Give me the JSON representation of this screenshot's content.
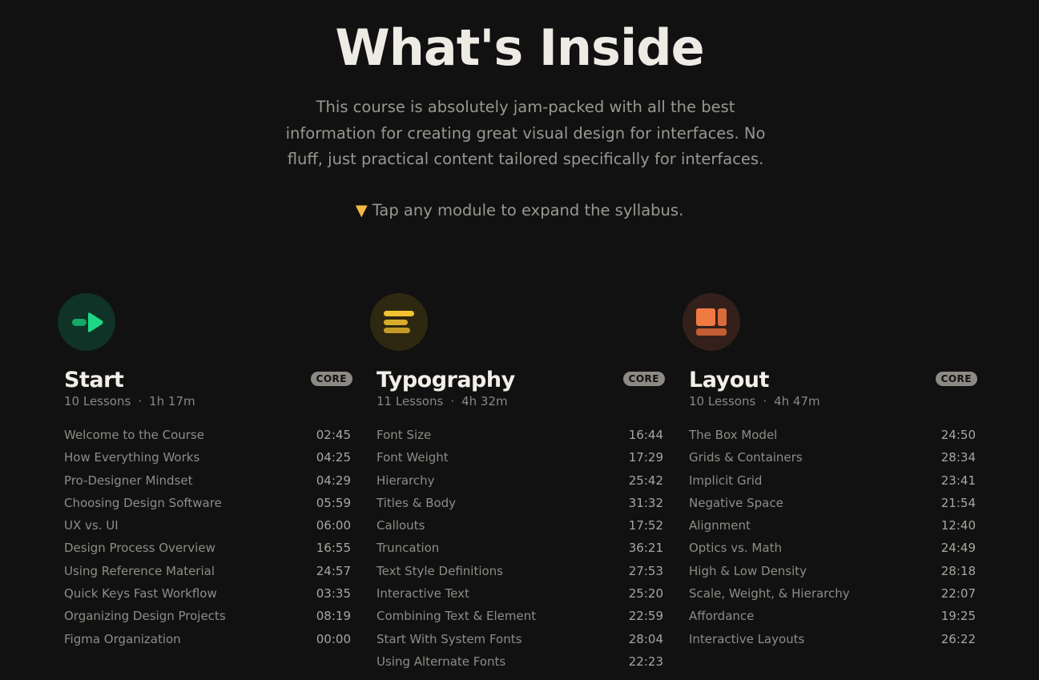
{
  "header": {
    "title": "What's Inside",
    "intro": "This course is absolutely jam-packed with all the best information for creating great visual design for interfaces. No fluff, just practical content tailored specifically for interfaces.",
    "hint": "Tap any module to expand the syllabus."
  },
  "colors": {
    "background": "#111111",
    "start_accent": "#1ed784",
    "typography_accent": "#f2c230",
    "layout_accent": "#f07a43"
  },
  "modules": [
    {
      "icon": "start-arrow-icon",
      "title": "Start",
      "badge": "CORE",
      "lessons_count": "10 Lessons",
      "duration": "1h 17m",
      "lessons": [
        {
          "name": "Welcome to the Course",
          "time": "02:45"
        },
        {
          "name": "How Everything Works",
          "time": "04:25"
        },
        {
          "name": "Pro-Designer Mindset",
          "time": "04:29"
        },
        {
          "name": "Choosing Design Software",
          "time": "05:59"
        },
        {
          "name": "UX vs. UI",
          "time": "06:00"
        },
        {
          "name": "Design Process Overview",
          "time": "16:55"
        },
        {
          "name": "Using Reference Material",
          "time": "24:57"
        },
        {
          "name": "Quick Keys Fast Workflow",
          "time": "03:35"
        },
        {
          "name": "Organizing Design Projects",
          "time": "08:19"
        },
        {
          "name": "Figma Organization",
          "time": "00:00"
        }
      ]
    },
    {
      "icon": "text-lines-icon",
      "title": "Typography",
      "badge": "CORE",
      "lessons_count": "11 Lessons",
      "duration": "4h 32m",
      "lessons": [
        {
          "name": "Font Size",
          "time": "16:44"
        },
        {
          "name": "Font Weight",
          "time": "17:29"
        },
        {
          "name": "Hierarchy",
          "time": "25:42"
        },
        {
          "name": "Titles & Body",
          "time": "31:32"
        },
        {
          "name": "Callouts",
          "time": "17:52"
        },
        {
          "name": "Truncation",
          "time": "36:21"
        },
        {
          "name": "Text Style Definitions",
          "time": "27:53"
        },
        {
          "name": "Interactive Text",
          "time": "25:20"
        },
        {
          "name": "Combining Text & Element",
          "time": "22:59"
        },
        {
          "name": "Start With System Fonts",
          "time": "28:04"
        },
        {
          "name": "Using Alternate Fonts",
          "time": "22:23"
        }
      ]
    },
    {
      "icon": "layout-blocks-icon",
      "title": "Layout",
      "badge": "CORE",
      "lessons_count": "10 Lessons",
      "duration": "4h 47m",
      "lessons": [
        {
          "name": "The Box Model",
          "time": "24:50"
        },
        {
          "name": "Grids & Containers",
          "time": "28:34"
        },
        {
          "name": "Implicit Grid",
          "time": "23:41"
        },
        {
          "name": "Negative Space",
          "time": "21:54"
        },
        {
          "name": "Alignment",
          "time": "12:40"
        },
        {
          "name": "Optics vs. Math",
          "time": "24:49"
        },
        {
          "name": "High & Low Density",
          "time": "28:18"
        },
        {
          "name": "Scale, Weight, & Hierarchy",
          "time": "22:07"
        },
        {
          "name": "Affordance",
          "time": "19:25"
        },
        {
          "name": "Interactive Layouts",
          "time": "26:22"
        }
      ]
    }
  ]
}
